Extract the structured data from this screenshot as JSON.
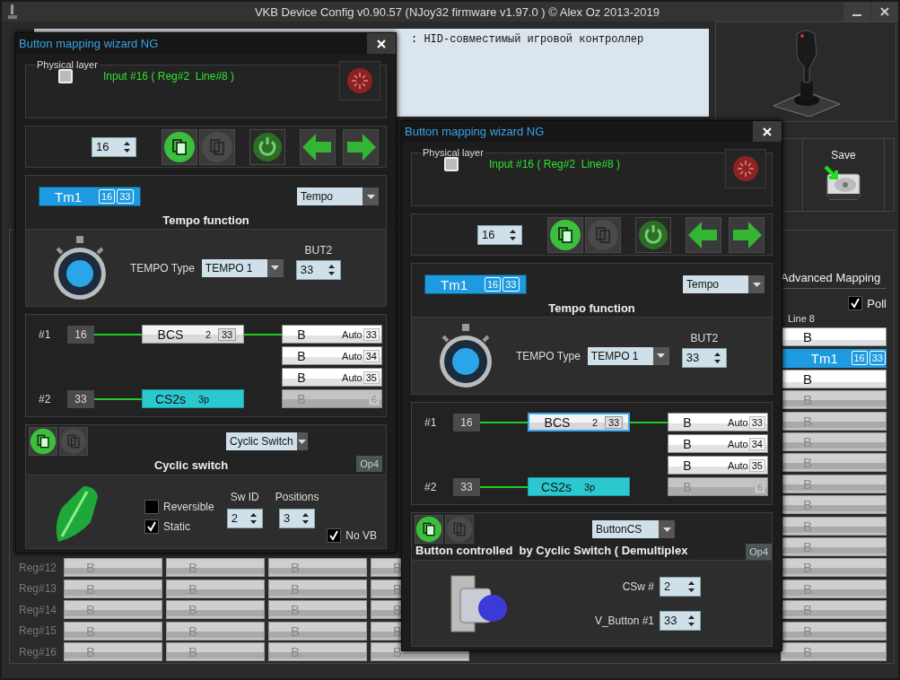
{
  "window": {
    "title": "VKB Device Config v0.90.57 (NJoy32 firmware v1.97.0  ) © Alex Oz 2013-2019"
  },
  "device_info": ": HID-совместимый игровой контроллер",
  "save_button": {
    "label": "Save"
  },
  "grid": {
    "tab": "Advanced Mapping",
    "poll": {
      "label": "Poll",
      "checked": true
    },
    "column_header": "Line 8",
    "line8": [
      {
        "kind": "assigned",
        "label": "B"
      },
      {
        "kind": "tempo",
        "label": "Tm1",
        "values": [
          "16",
          "33"
        ]
      },
      {
        "kind": "assigned",
        "label": "B"
      },
      {
        "kind": "empty",
        "label": "B"
      },
      {
        "kind": "empty",
        "label": "B"
      },
      {
        "kind": "empty",
        "label": "B"
      },
      {
        "kind": "empty",
        "label": "B"
      },
      {
        "kind": "empty",
        "label": "B"
      },
      {
        "kind": "empty",
        "label": "B"
      },
      {
        "kind": "empty",
        "label": "B"
      },
      {
        "kind": "empty",
        "label": "B"
      },
      {
        "kind": "empty",
        "label": "B"
      },
      {
        "kind": "empty",
        "label": "B"
      },
      {
        "kind": "empty",
        "label": "B"
      },
      {
        "kind": "empty",
        "label": "B"
      },
      {
        "kind": "empty",
        "label": "B"
      }
    ],
    "rows": [
      {
        "label": "Reg#12",
        "cells": [
          "B",
          "B",
          "B",
          "B"
        ]
      },
      {
        "label": "Reg#13",
        "cells": [
          "B",
          "B",
          "B",
          "B"
        ]
      },
      {
        "label": "Reg#14",
        "cells": [
          "B",
          "B",
          "B",
          "B"
        ]
      },
      {
        "label": "Reg#15",
        "cells": [
          "B",
          "B",
          "B",
          "B"
        ]
      },
      {
        "label": "Reg#16",
        "cells": [
          "B",
          "B",
          "B",
          "B"
        ]
      }
    ]
  },
  "dialogs": [
    {
      "title": "Button mapping wizard NG",
      "physical": {
        "legend": "Physical layer",
        "input_text": "Input #16 ( Reg#2  Line#8 )"
      },
      "nav": {
        "value": "16"
      },
      "function": {
        "badge": {
          "label": "Tm1",
          "values": [
            "16",
            "33"
          ]
        },
        "type": "Tempo",
        "heading": "Tempo function",
        "tempo_type_label": "TEMPO Type",
        "tempo_type": "TEMPO 1",
        "but2_label": "BUT2",
        "but2": "33"
      },
      "chain": {
        "in1": {
          "label": "#1",
          "value": "16"
        },
        "bcs": {
          "label": "BCS",
          "count": "2",
          "value": "33",
          "selected": false
        },
        "in2": {
          "label": "#2",
          "value": "33"
        },
        "cs": {
          "label": "CS2s",
          "positions": "3p"
        },
        "outputs": [
          {
            "label": "B",
            "mode": "Auto",
            "value": "33",
            "disabled": false
          },
          {
            "label": "B",
            "mode": "Auto",
            "value": "34",
            "disabled": false
          },
          {
            "label": "B",
            "mode": "Auto",
            "value": "35",
            "disabled": false
          },
          {
            "label": "B",
            "value": "6",
            "disabled": true
          }
        ]
      },
      "module": {
        "kind": "cyclic",
        "type": "Cyclic Switch",
        "heading": "Cyclic switch",
        "op": "Op4",
        "reversible": {
          "label": "Reversible",
          "checked": false
        },
        "static": {
          "label": "Static",
          "checked": true
        },
        "fields": [
          {
            "label": "Sw ID",
            "value": "2"
          },
          {
            "label": "Positions",
            "value": "3"
          }
        ],
        "no_vb": {
          "label": "No VB",
          "checked": true
        }
      }
    },
    {
      "title": "Button mapping wizard NG",
      "physical": {
        "legend": "Physical layer",
        "input_text": "Input #16 ( Reg#2  Line#8 )"
      },
      "nav": {
        "value": "16"
      },
      "function": {
        "badge": {
          "label": "Tm1",
          "values": [
            "16",
            "33"
          ]
        },
        "type": "Tempo",
        "heading": "Tempo function",
        "tempo_type_label": "TEMPO Type",
        "tempo_type": "TEMPO 1",
        "but2_label": "BUT2",
        "but2": "33"
      },
      "chain": {
        "in1": {
          "label": "#1",
          "value": "16"
        },
        "bcs": {
          "label": "BCS",
          "count": "2",
          "value": "33",
          "selected": true
        },
        "in2": {
          "label": "#2",
          "value": "33"
        },
        "cs": {
          "label": "CS2s",
          "positions": "3p"
        },
        "outputs": [
          {
            "label": "B",
            "mode": "Auto",
            "value": "33",
            "disabled": false
          },
          {
            "label": "B",
            "mode": "Auto",
            "value": "34",
            "disabled": false
          },
          {
            "label": "B",
            "mode": "Auto",
            "value": "35",
            "disabled": false
          },
          {
            "label": "B",
            "value": "6",
            "disabled": true
          }
        ]
      },
      "module": {
        "kind": "buttoncs",
        "type": "ButtonCS",
        "heading": "Button controlled  by Cyclic Switch ( Demultiplex",
        "op": "Op4",
        "fields": [
          {
            "label": "CSw #",
            "value": "2"
          },
          {
            "label": "V_Button #1",
            "value": "33"
          }
        ]
      }
    }
  ]
}
